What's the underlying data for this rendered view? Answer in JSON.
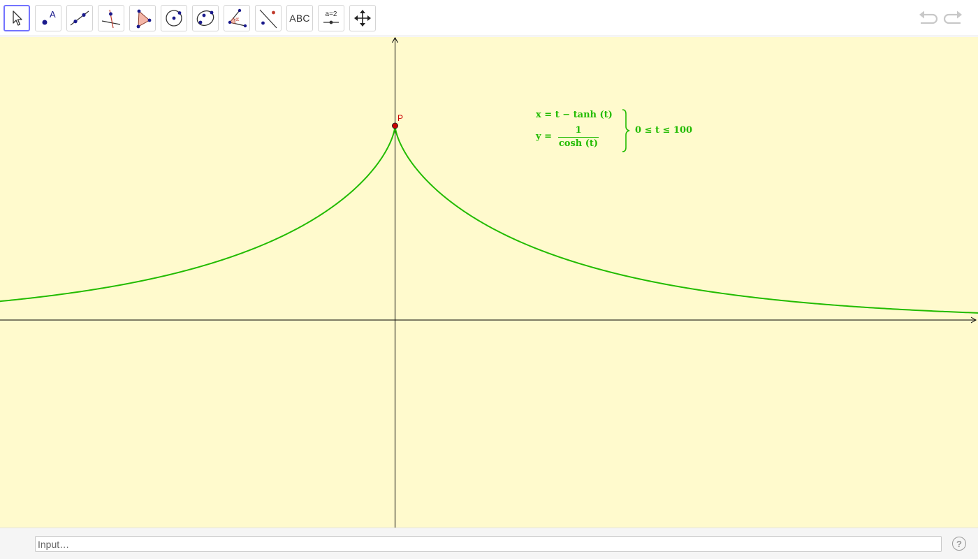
{
  "toolbar": {
    "tools": [
      {
        "name": "move-tool",
        "icon": "arrow-cursor-icon"
      },
      {
        "name": "point-tool",
        "icon": "point-icon",
        "label": "A"
      },
      {
        "name": "line-tool",
        "icon": "line-through-two-points-icon"
      },
      {
        "name": "perpendicular-line-tool",
        "icon": "perpendicular-line-icon"
      },
      {
        "name": "polygon-tool",
        "icon": "polygon-icon"
      },
      {
        "name": "circle-tool",
        "icon": "circle-center-point-icon"
      },
      {
        "name": "ellipse-tool",
        "icon": "conic-through-points-icon"
      },
      {
        "name": "angle-tool",
        "icon": "angle-icon",
        "label": "α"
      },
      {
        "name": "reflect-tool",
        "icon": "reflect-about-line-icon"
      },
      {
        "name": "text-tool",
        "icon": "text-icon",
        "label": "ABC"
      },
      {
        "name": "slider-tool",
        "icon": "slider-icon",
        "label": "a=2"
      },
      {
        "name": "move-graphics-view-tool",
        "icon": "move-arrows-icon"
      }
    ],
    "undo_icon": "undo-icon",
    "redo_icon": "redo-icon"
  },
  "graphics": {
    "point_label": "P",
    "colors": {
      "background": "#fffacd",
      "curve": "#22bb00",
      "point": "#cc0000",
      "axes": "#000000"
    },
    "formula": {
      "x_eq": "x = t − tanh (t)",
      "y_eq_lhs": "y =",
      "y_num": "1",
      "y_den": "cosh (t)",
      "range": "0 ≤ t ≤ 100"
    }
  },
  "input_bar": {
    "placeholder": "Input…",
    "value": "",
    "help_icon": "help-icon",
    "help_label": "?"
  }
}
